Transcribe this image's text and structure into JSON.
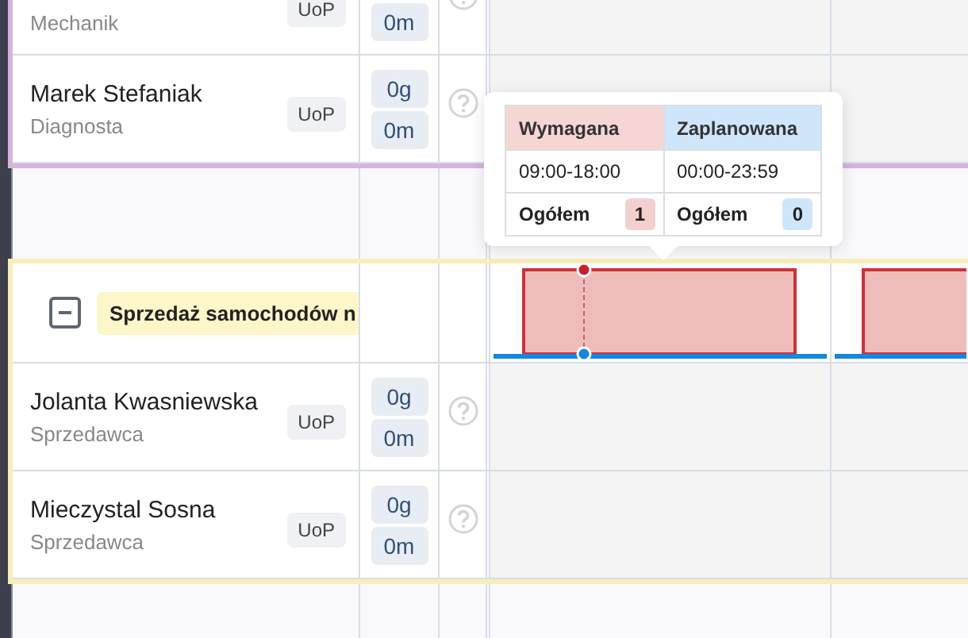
{
  "groups": [
    {
      "color": "#d9b3de",
      "employees": [
        {
          "role": "Mechanik",
          "contract": "UoP",
          "minutes": "0m"
        },
        {
          "name": "Marek Stefaniak",
          "role": "Diagnosta",
          "contract": "UoP",
          "hours": "0g",
          "minutes": "0m"
        }
      ]
    },
    {
      "color": "#f8eeb8",
      "header": "Sprzedaż samochodów n",
      "expanded": true,
      "employees": [
        {
          "name": "Jolanta Kwasniewska",
          "role": "Sprzedawca",
          "contract": "UoP",
          "hours": "0g",
          "minutes": "0m"
        },
        {
          "name": "Mieczystal Sosna",
          "role": "Sprzedawca",
          "contract": "UoP",
          "hours": "0g",
          "minutes": "0m"
        }
      ]
    }
  ],
  "tooltip": {
    "columns": [
      {
        "kind": "required",
        "heading": "Wymagana",
        "time": "09:00-18:00",
        "total_label": "Ogółem",
        "total": "1"
      },
      {
        "kind": "planned",
        "heading": "Zaplanowana",
        "time": "00:00-23:59",
        "total_label": "Ogółem",
        "total": "0"
      }
    ]
  }
}
